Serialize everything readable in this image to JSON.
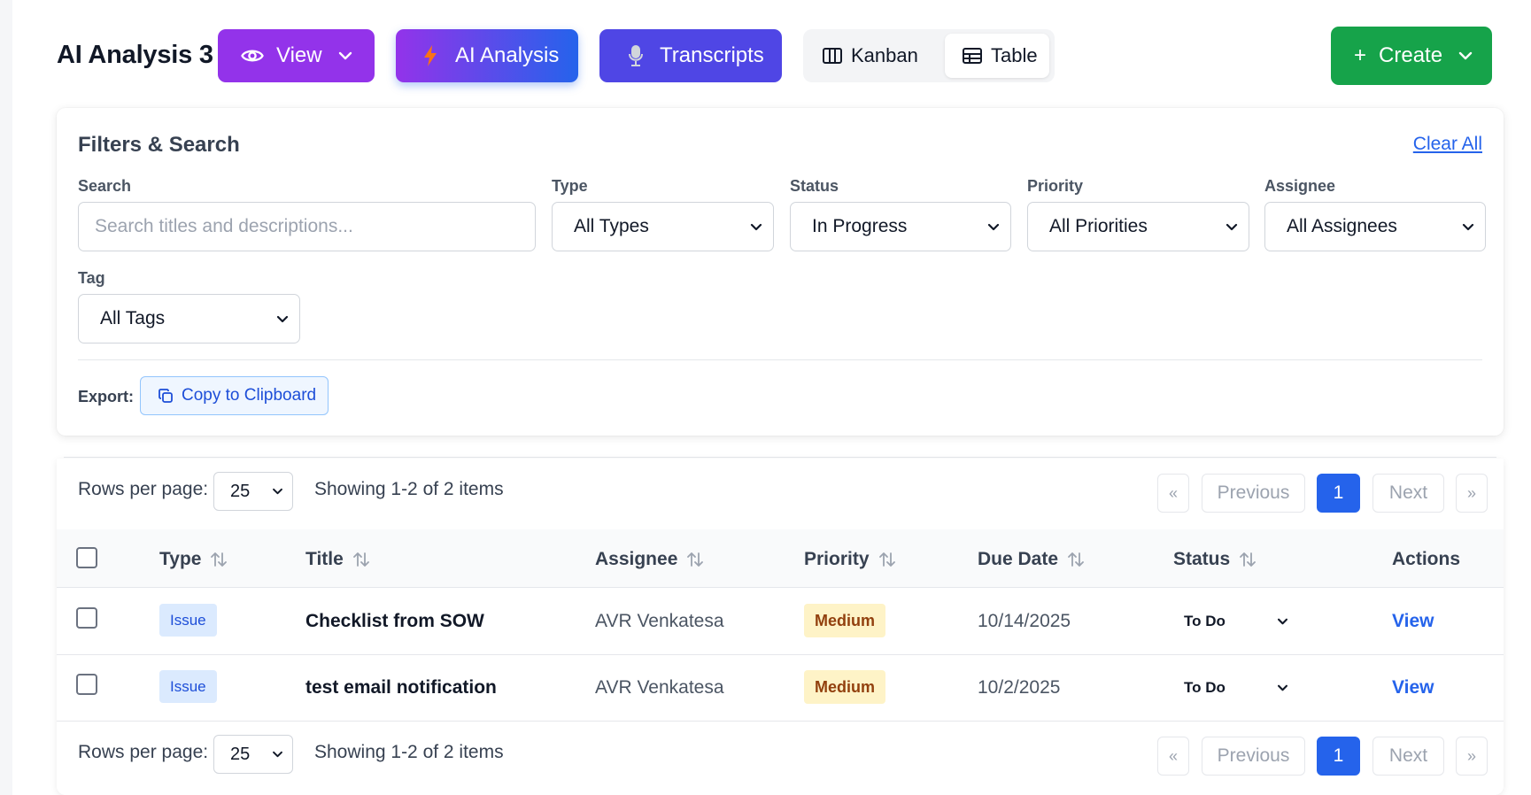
{
  "header": {
    "title": "AI Analysis 3",
    "view_label": "View",
    "ai_analysis_label": "AI Analysis",
    "transcripts_label": "Transcripts",
    "kanban_label": "Kanban",
    "table_label": "Table",
    "create_label": "Create",
    "create_plus": "+",
    "colors": {
      "view": "#9333ea",
      "ai_start": "#9333ea",
      "ai_end": "#2563eb",
      "transcripts": "#4f46e5",
      "create": "#16a34a"
    }
  },
  "filters": {
    "title": "Filters & Search",
    "clear_all": "Clear All",
    "search": {
      "label": "Search",
      "placeholder": "Search titles and descriptions..."
    },
    "type": {
      "label": "Type",
      "value": "All Types"
    },
    "status": {
      "label": "Status",
      "value": "In Progress"
    },
    "priority": {
      "label": "Priority",
      "value": "All Priorities"
    },
    "assignee": {
      "label": "Assignee",
      "value": "All Assignees"
    },
    "tag": {
      "label": "Tag",
      "value": "All Tags"
    },
    "export_label": "Export:",
    "copy_label": "Copy to Clipboard"
  },
  "pagination": {
    "rows_per_page_label": "Rows per page:",
    "rows_per_page": "25",
    "showing": "Showing 1-2 of 2 items",
    "first": "«",
    "previous": "Previous",
    "current_page": "1",
    "next": "Next",
    "last": "»"
  },
  "table": {
    "columns": [
      "Type",
      "Title",
      "Assignee",
      "Priority",
      "Due Date",
      "Status",
      "Actions"
    ],
    "rows": [
      {
        "type": "Issue",
        "title": "Checklist from SOW",
        "assignee": "AVR Venkatesa",
        "priority": "Medium",
        "due_date": "10/14/2025",
        "status": "To Do",
        "action": "View"
      },
      {
        "type": "Issue",
        "title": "test email notification",
        "assignee": "AVR Venkatesa",
        "priority": "Medium",
        "due_date": "10/2/2025",
        "status": "To Do",
        "action": "View"
      }
    ]
  }
}
